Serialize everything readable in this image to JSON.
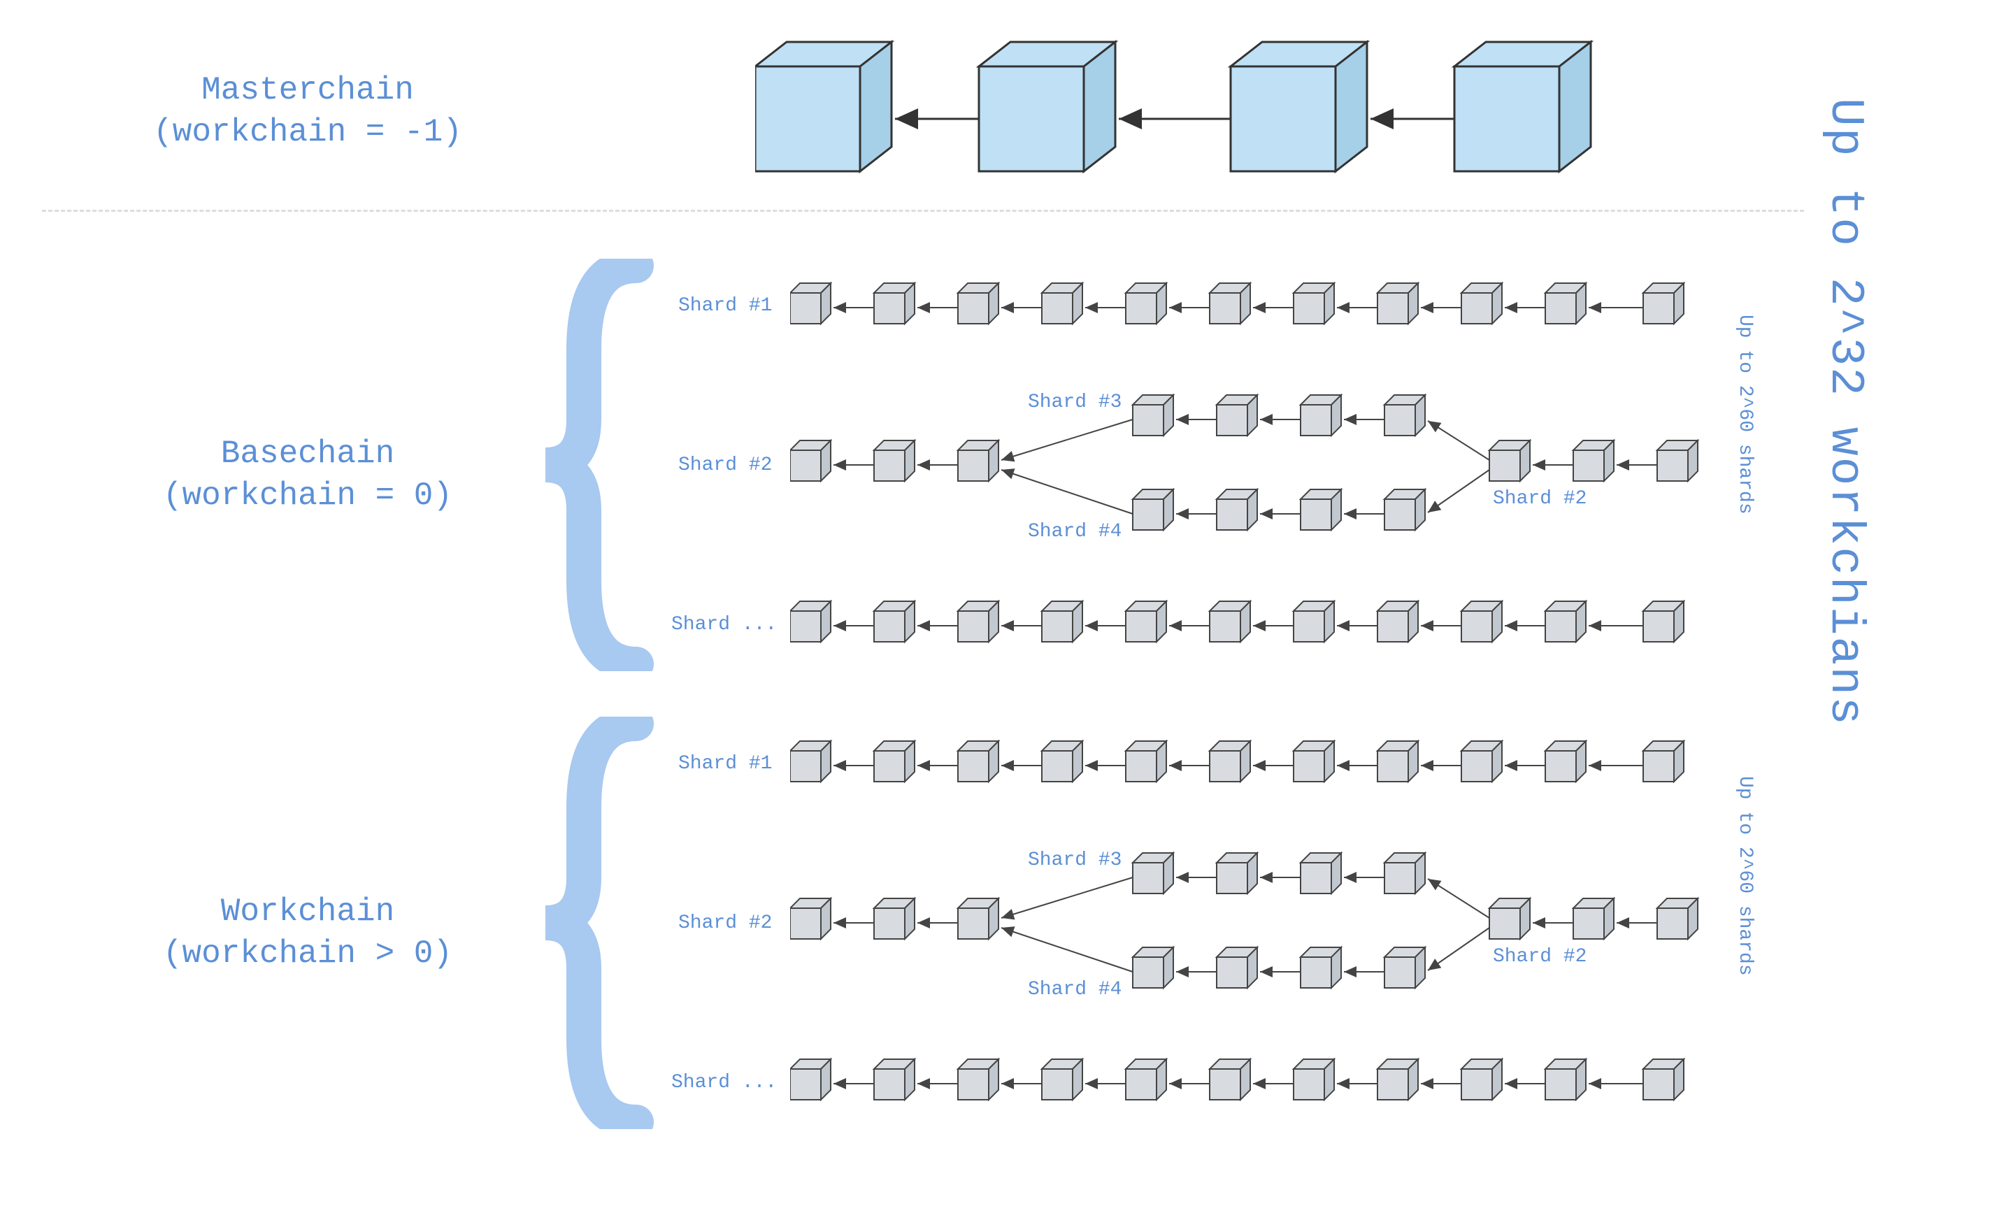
{
  "masterchain": {
    "title_line1": "Masterchain",
    "title_line2": "(workchain = -1)"
  },
  "basechain": {
    "title_line1": "Basechain",
    "title_line2": "(workchain = 0)",
    "shard1": "Shard #1",
    "shard2": "Shard #2",
    "shard3": "Shard #3",
    "shard4": "Shard #4",
    "shard_dots": "Shard ...",
    "shard2_merge": "Shard #2",
    "shards_note": "Up to 2^60 shards"
  },
  "workchain": {
    "title_line1": "Workchain",
    "title_line2": "(workchain > 0)",
    "shard1": "Shard #1",
    "shard2": "Shard #2",
    "shard3": "Shard #3",
    "shard4": "Shard #4",
    "shard_dots": "Shard ...",
    "shard2_merge": "Shard #2",
    "shards_note": "Up to 2^60 shards"
  },
  "right_note": "Up to 2^32 workchians",
  "colors": {
    "cube_master_fill": "#bfe0f5",
    "cube_master_stroke": "#333",
    "cube_small_fill": "#d8dce0",
    "cube_small_stroke": "#444",
    "label_blue": "#5b8fd6",
    "brace_fill": "#a8c9f0"
  }
}
